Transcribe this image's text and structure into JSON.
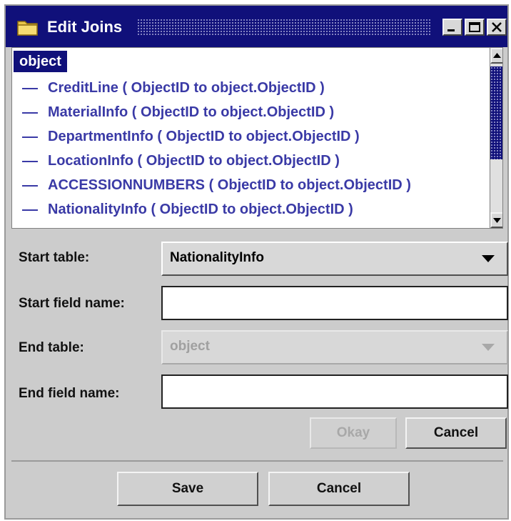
{
  "window": {
    "title": "Edit Joins",
    "icon": "folder-icon",
    "controls": [
      "minimize-icon",
      "maximize-icon",
      "close-icon"
    ]
  },
  "tree": {
    "root": "object",
    "items": [
      "CreditLine ( ObjectID to object.ObjectID )",
      "MaterialInfo ( ObjectID to object.ObjectID )",
      "DepartmentInfo ( ObjectID to object.ObjectID )",
      "LocationInfo ( ObjectID to object.ObjectID )",
      "ACCESSIONNUMBERS ( ObjectID to object.ObjectID )",
      "NationalityInfo ( ObjectID to object.ObjectID )"
    ]
  },
  "form": {
    "start_table_label": "Start table:",
    "start_table_value": "NationalityInfo",
    "start_field_label": "Start field name:",
    "start_field_value": "",
    "end_table_label": "End table:",
    "end_table_value": "object",
    "end_field_label": "End field name:",
    "end_field_value": "",
    "okay_label": "Okay",
    "cancel_label": "Cancel"
  },
  "footer": {
    "save_label": "Save",
    "cancel_label": "Cancel"
  },
  "colors": {
    "title_bar": "#10107a",
    "selection": "#10107a",
    "tree_text": "#3a3aa6",
    "window_bg": "#cccccc"
  }
}
